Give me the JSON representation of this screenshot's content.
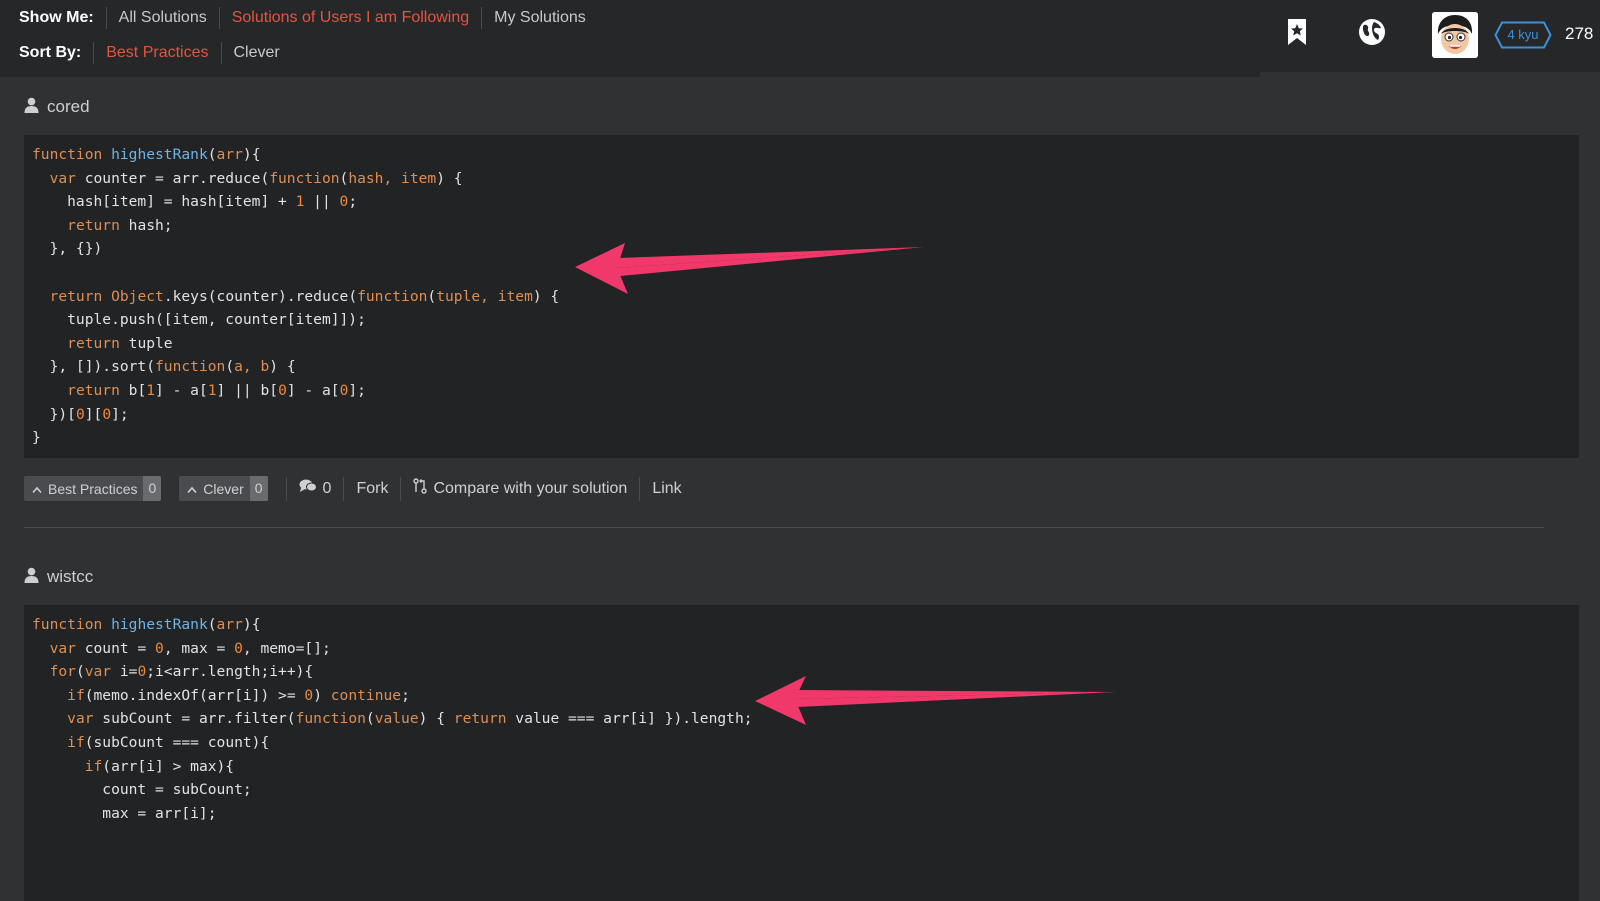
{
  "filters": {
    "show_label": "Show Me:",
    "show_options": [
      "All Solutions",
      "Solutions of Users I am Following",
      "My Solutions"
    ],
    "show_active": "Solutions of Users I am Following",
    "sort_label": "Sort By:",
    "sort_options": [
      "Best Practices",
      "Clever"
    ],
    "sort_active": "Best Practices"
  },
  "user_panel": {
    "bookmark_icon": "bookmark-star-icon",
    "globe_icon": "globe-icon",
    "rank": "4 kyu",
    "honor": "278"
  },
  "solutions": [
    {
      "author": "cored",
      "actions": {
        "best_practices_label": "Best Practices",
        "best_practices_count": "0",
        "clever_label": "Clever",
        "clever_count": "0",
        "comments_count": "0",
        "fork": "Fork",
        "compare": "Compare with your solution",
        "link": "Link"
      }
    },
    {
      "author": "wistcc"
    }
  ],
  "colors": {
    "accent": "#e4543f",
    "kyu_blue": "#3c90d6",
    "arrow": "#f1386b"
  }
}
